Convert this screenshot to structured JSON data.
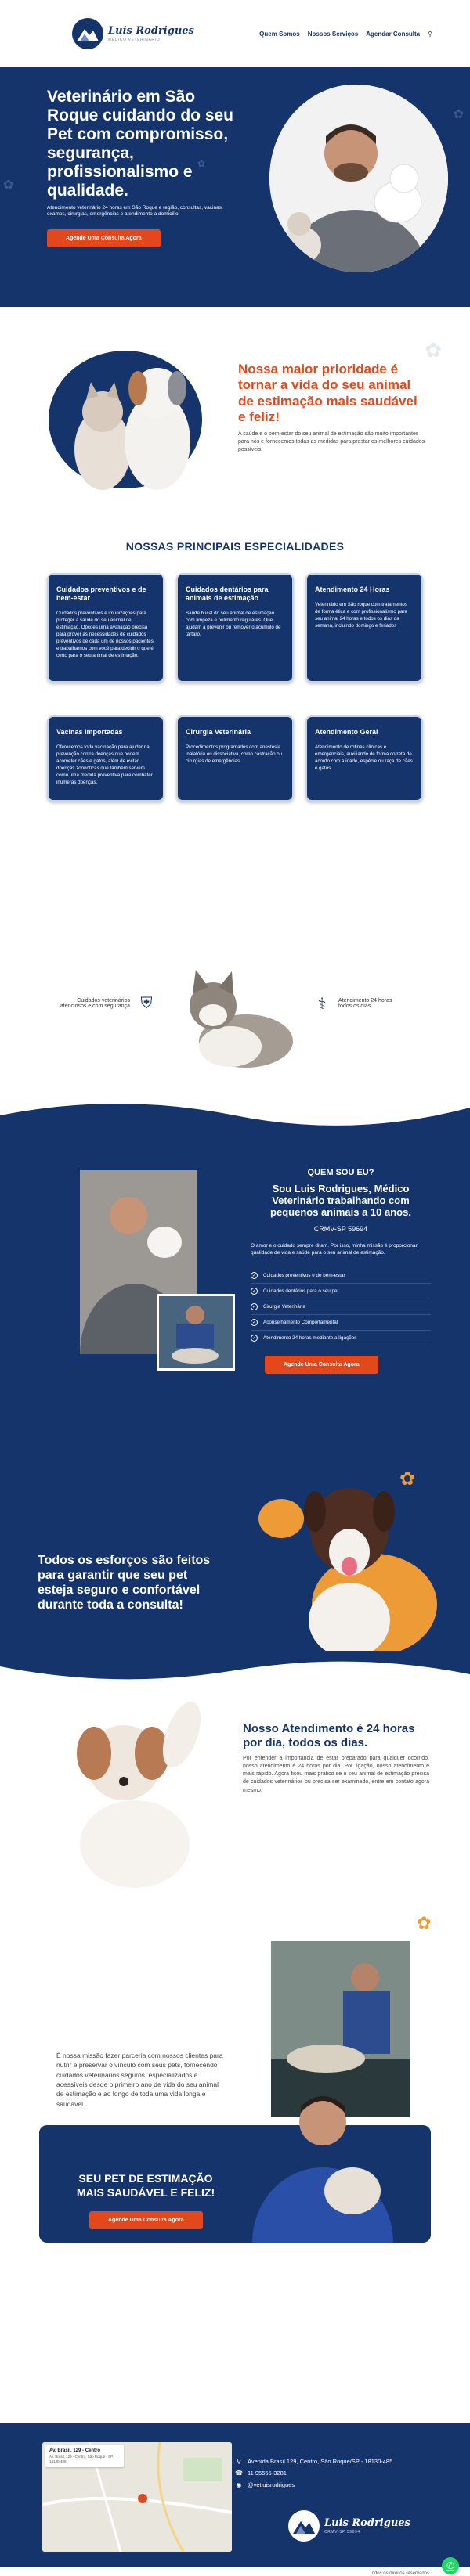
{
  "brand": {
    "name": "Luis Rodrigues",
    "subtitle": "MÉDICO VETERINÁRIO"
  },
  "nav": {
    "items": [
      "Quem Somos",
      "Nossos Serviços",
      "Agendar Consulta"
    ],
    "search_icon": "search-icon"
  },
  "hero": {
    "title": "Veterinário em São Roque cuidando do seu Pet com compromisso, segurança, profissionalismo e qualidade.",
    "description": "Atendimento veterinário 24 horas em São Roque e região, consultas, vacinas, exames, cirurgias, emergências e atendimento a domicílio",
    "cta": "Agende Uma Consulta Agora"
  },
  "priority": {
    "title": "Nossa maior prioridade é tornar a vida do seu animal de estimação mais saudável e feliz!",
    "text": "A saúde e o bem-estar do seu animal de estimação são muito importantes para nós e fornecemos todas as medidas para prestar os melhores cuidados possíveis."
  },
  "specialties": {
    "title": "NOSSAS PRINCIPAIS ESPECIALIDADES",
    "cards": [
      {
        "title": "Cuidados preventivos e de bem-estar",
        "text": "Cuidados preventivos e imunizações para proteger a saúde do seu animal de estimação. Opções uma avaliação precisa para prover as necessidades de cuidados preventivos de cada um de nossos pacientes e trabalhamos com você para decidir o que é certo para o seu animal de estimação."
      },
      {
        "title": "Cuidados dentários para animais de estimação",
        "text": "Saúde bucal do seu animal de estimação com limpeza e polimento regulares. Que ajudam a prevenir ou remover o acúmulo de tártaro."
      },
      {
        "title": "Atendimento 24 Horas",
        "text": "Veterinário em São roque com tratamentos de forma ética e com profissionalismo para seu animal 24 horas e todos os dias da semana, incluindo domingo e feriados"
      },
      {
        "title": "Vacinas Importadas",
        "text": "Oferecemos toda vacinação para ajudar na prevenção contra doenças que podem acometer cães e gatos, além de evitar doenças zoonóticas que também servem como uma medida preventiva para combater inúmeras doenças."
      },
      {
        "title": "Cirurgia Veterinária",
        "text": "Procedimentos programados com anestesia inalatória ou dissociativa, como castração ou cirurgias de emergências."
      },
      {
        "title": "Atendimento Geral",
        "text": "Atendimento de rotinas clínicas e emergenciais, auxiliando de forma correta de acordo com a idade, espécie ou raça de cães e gatos."
      }
    ]
  },
  "features": [
    {
      "label": "Cuidados veterinários atenciosos e com segurança",
      "icon": "shield-paw-icon"
    },
    {
      "label": "Atendimento 24 horas todos os dias",
      "icon": "stethoscope-icon"
    }
  ],
  "about": {
    "small_title": "QUEM SOU EU?",
    "title": "Sou Luis Rodrigues, Médico Veterinário trabalhando com pequenos animais a 10 anos.",
    "crmv": "CRMV-SP 59694",
    "lead": "O amor e o cuidado sempre ditam. Por isso, minha missão é proporcionar qualidade de vida e saúde para o seu animal de estimação.",
    "checks": [
      "Cuidados preventivos e de bem-estar",
      "Cuidados dentários para o seu pet",
      "Cirurgia Veterinária",
      "Aconselhamento Comportamental",
      "Atendimento 24 horas mediante a ligações"
    ],
    "cta": "Agende Uma Consulta Agora"
  },
  "efforts": {
    "title": "Todos os esforços são feitos para garantir que seu pet esteja seguro e confortável durante toda a consulta!"
  },
  "h24": {
    "title": "Nosso Atendimento é 24 horas por dia, todos os dias.",
    "text": "Por entender a importância de estar preparado para qualquer ocorrido, nosso atendimento é 24 horas por dia. Por ligação, nosso atendimento é mais rápido. Agora ficou mais prático se o seu animal de estimação precisa de cuidados veterinários ou precisa ser examinado, entre em contato agora mesmo."
  },
  "mission": {
    "text": "É nossa missão fazer parceria com nossos clientes para nutrir e preservar o vínculo com seus pets, fornecendo cuidados veterinários seguros, especializados e acessíveis desde o primeiro ano de vida do seu animal de estimação e ao longo de toda uma vida longa e saudável."
  },
  "cta": {
    "title": "SEU PET DE ESTIMAÇÃO MAIS SAUDÁVEL E FELIZ!",
    "button": "Agende Uma Consulta Agora"
  },
  "footer": {
    "map_title": "Av. Brasil, 129 - Centro",
    "map_address": "Av. Brasil, 129 - Centro, São Roque - SP, 18130-485",
    "address": "Avenida Brasil 129, Centro, São Roque/SP - 18130-485",
    "phone": "11 95555-3281",
    "instagram": "@vetluisrodrigues",
    "crmv": "CRMV-SP 59694",
    "copyright": "Todos os direitos reservados"
  },
  "colors": {
    "navy": "#15346b",
    "orange": "#e2481c",
    "orange_blob": "#ec9b36",
    "whatsapp": "#25d366"
  }
}
